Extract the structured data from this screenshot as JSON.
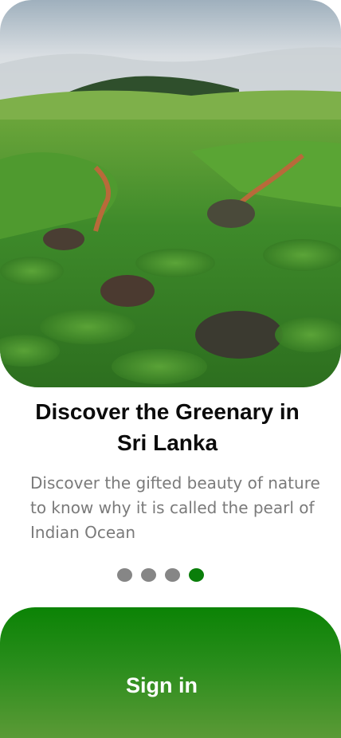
{
  "hero": {
    "image_name": "sri-lanka-tea-plantation-photo"
  },
  "onboarding": {
    "title": "Discover the Greenary in Sri Lanka",
    "description": "Discover the gifted beauty of nature to know why it is called the pearl  of Indian Ocean",
    "pagination": {
      "total": 4,
      "current": 4
    }
  },
  "cta": {
    "sign_in_label": "Sign in"
  },
  "colors": {
    "primary_green": "#0a7e0a",
    "dot_inactive": "#868686",
    "title_text": "#0b0b0b",
    "description_text": "#7a7a7a"
  }
}
